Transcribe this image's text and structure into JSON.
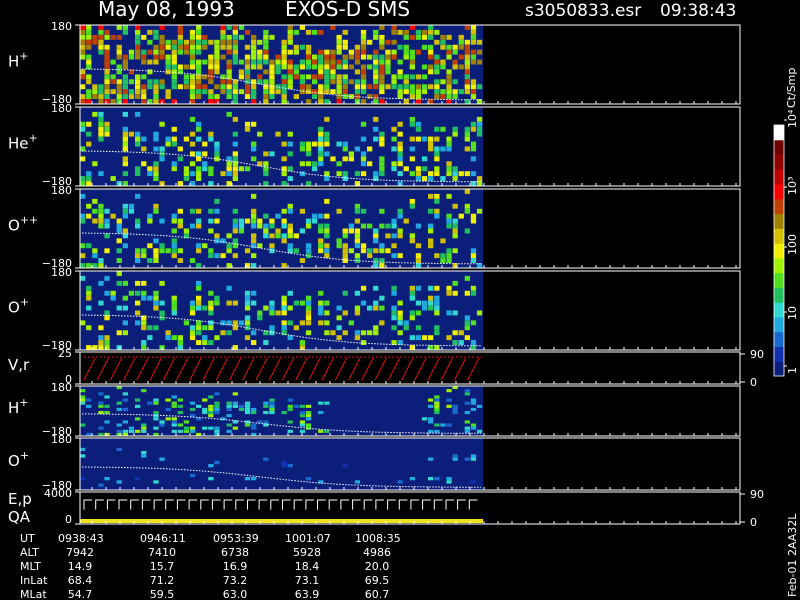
{
  "header": {
    "date": "May 08, 1993",
    "instrument": "EXOS-D SMS",
    "file": "s3050833.esr",
    "time": "09:38:43"
  },
  "colors": {
    "background": "#000000",
    "panel_fill": "#0b1f7a",
    "trace": "#ffffff",
    "ramp_red": "#e01010",
    "qa_bar": "#f0e020"
  },
  "chart_data": {
    "type": "heatmap",
    "x_range": [
      "09:38:43",
      "10:13:30"
    ],
    "plotted_until": "10:13:30",
    "panels": [
      {
        "label": "H",
        "sup": "+",
        "ytop": "180",
        "ybot": "−180",
        "ylim": [
          -180,
          180
        ],
        "tint": "bright"
      },
      {
        "label": "He",
        "sup": "+",
        "ytop": "180",
        "ybot": "−180",
        "ylim": [
          -180,
          180
        ],
        "tint": "mid"
      },
      {
        "label": "O",
        "sup": "++",
        "ytop": "180",
        "ybot": "−180",
        "ylim": [
          -180,
          180
        ],
        "tint": "mid"
      },
      {
        "label": "O",
        "sup": "+",
        "ytop": "180",
        "ybot": "−180",
        "ylim": [
          -180,
          180
        ],
        "tint": "mid"
      },
      {
        "label": "V,r",
        "sup": "",
        "ytop": "25",
        "ybot": "0",
        "rtop": "90",
        "rbot": "0",
        "kind": "ramp"
      },
      {
        "label": "H",
        "sup": "+",
        "ytop": "180",
        "ybot": "−180",
        "ylim": [
          -180,
          180
        ],
        "tint": "low"
      },
      {
        "label": "O",
        "sup": "+",
        "ytop": "180",
        "ybot": "−180",
        "ylim": [
          -180,
          180
        ],
        "tint": "sparse"
      },
      {
        "label": "E,p",
        "label2": "QA",
        "sup": "",
        "ytop": "4000",
        "ybot": "0",
        "rtop": "90",
        "rbot": "0",
        "kind": "energy"
      }
    ],
    "colorbar": {
      "unit": "Ct/Smp",
      "ticks": [
        "1",
        "10",
        "100",
        "10³",
        "10⁴"
      ],
      "scale": "log",
      "range": [
        1,
        10000
      ],
      "colors": [
        "#0b1f7a",
        "#1030b0",
        "#1868d0",
        "#20a8e0",
        "#30d8d0",
        "#20c060",
        "#50e020",
        "#a0f000",
        "#f0f000",
        "#d0c000",
        "#a08000",
        "#c04000",
        "#ff0000",
        "#c00000",
        "#900000",
        "#700000",
        "#ffffff"
      ]
    },
    "ephemeris": {
      "rows": [
        {
          "name": "UT",
          "values": [
            "0938:43",
            "0946:11",
            "0953:39",
            "1001:07",
            "1008:35"
          ]
        },
        {
          "name": "ALT",
          "values": [
            "7942",
            "7410",
            "6738",
            "5928",
            "4986"
          ]
        },
        {
          "name": "MLT",
          "values": [
            "14.9",
            "15.7",
            "16.9",
            "18.4",
            "20.0"
          ]
        },
        {
          "name": "InLat",
          "values": [
            "68.4",
            "71.2",
            "73.2",
            "73.1",
            "69.5"
          ]
        },
        {
          "name": "MLat",
          "values": [
            "54.7",
            "59.5",
            "63.0",
            "63.9",
            "60.7"
          ]
        }
      ]
    },
    "side_note": "Feb-01 2AA32L"
  }
}
